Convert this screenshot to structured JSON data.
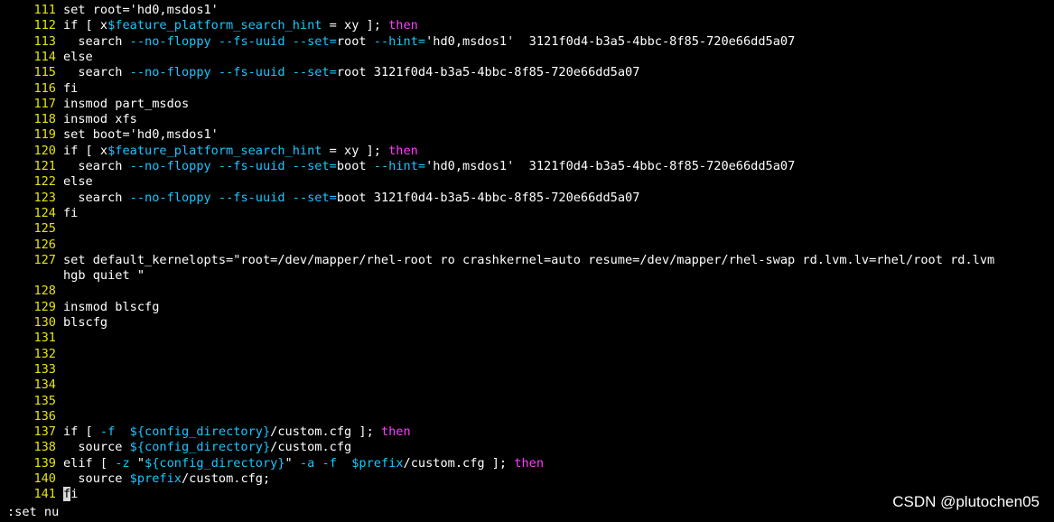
{
  "terminal": {
    "command_line": ":set nu",
    "watermark": "CSDN @plutochen05"
  },
  "lines": [
    {
      "n": "111",
      "t": "set root='hd0,msdos1'"
    },
    {
      "n": "112",
      "t": "if [ x$feature_platform_search_hint = xy ]; then"
    },
    {
      "n": "113",
      "t": "  search --no-floppy --fs-uuid --set=root --hint='hd0,msdos1'  3121f0d4-b3a5-4bbc-8f85-720e66dd5a07"
    },
    {
      "n": "114",
      "t": "else"
    },
    {
      "n": "115",
      "t": "  search --no-floppy --fs-uuid --set=root 3121f0d4-b3a5-4bbc-8f85-720e66dd5a07"
    },
    {
      "n": "116",
      "t": "fi"
    },
    {
      "n": "117",
      "t": "insmod part_msdos"
    },
    {
      "n": "118",
      "t": "insmod xfs"
    },
    {
      "n": "119",
      "t": "set boot='hd0,msdos1'"
    },
    {
      "n": "120",
      "t": "if [ x$feature_platform_search_hint = xy ]; then"
    },
    {
      "n": "121",
      "t": "  search --no-floppy --fs-uuid --set=boot --hint='hd0,msdos1'  3121f0d4-b3a5-4bbc-8f85-720e66dd5a07"
    },
    {
      "n": "122",
      "t": "else"
    },
    {
      "n": "123",
      "t": "  search --no-floppy --fs-uuid --set=boot 3121f0d4-b3a5-4bbc-8f85-720e66dd5a07"
    },
    {
      "n": "124",
      "t": "fi"
    },
    {
      "n": "125",
      "t": ""
    },
    {
      "n": "126",
      "t": ""
    },
    {
      "n": "127",
      "t": "set default_kernelopts=\"root=/dev/mapper/rhel-root ro crashkernel=auto resume=/dev/mapper/rhel-swap rd.lvm.lv=rhel/root rd.lvm",
      "wrap": "hgb quiet \""
    },
    {
      "n": "128",
      "t": ""
    },
    {
      "n": "129",
      "t": "insmod blscfg"
    },
    {
      "n": "130",
      "t": "blscfg"
    },
    {
      "n": "131",
      "t": ""
    },
    {
      "n": "132",
      "t": ""
    },
    {
      "n": "133",
      "t": ""
    },
    {
      "n": "134",
      "t": ""
    },
    {
      "n": "135",
      "t": ""
    },
    {
      "n": "136",
      "t": ""
    },
    {
      "n": "137",
      "t": "if [ -f  ${config_directory}/custom.cfg ]; then"
    },
    {
      "n": "138",
      "t": "  source ${config_directory}/custom.cfg"
    },
    {
      "n": "139",
      "t": "elif [ -z \"${config_directory}\" -a -f  $prefix/custom.cfg ]; then"
    },
    {
      "n": "140",
      "t": "  source $prefix/custom.cfg;"
    },
    {
      "n": "141",
      "t": "fi",
      "cursor": "f"
    }
  ],
  "colors": {
    "background": "#000000",
    "line_number": "#e5e50a",
    "keyword": "#ff3cff",
    "variable": "#19c6ff",
    "text": "#ffffff"
  }
}
